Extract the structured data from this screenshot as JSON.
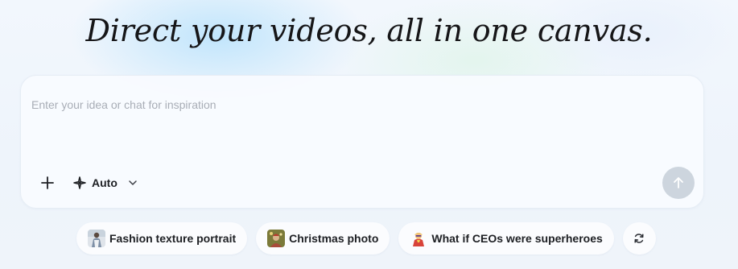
{
  "hero": {
    "title": "Direct your videos, all in one canvas."
  },
  "composer": {
    "placeholder": "Enter your idea or chat for inspiration",
    "value": "",
    "mode": {
      "label": "Auto",
      "icon": "sparkle-move-icon"
    },
    "add_icon": "plus-icon",
    "send_icon": "arrow-up-icon",
    "send_enabled": false,
    "send_color": "#cdd5de"
  },
  "suggestions": [
    {
      "label": "Fashion texture portrait",
      "icon": "fashion-portrait-thumbnail"
    },
    {
      "label": "Christmas photo",
      "icon": "christmas-photo-thumbnail"
    },
    {
      "label": "What if CEOs were superheroes",
      "icon": "superhero-emoji"
    }
  ],
  "refresh_icon": "refresh-icon"
}
